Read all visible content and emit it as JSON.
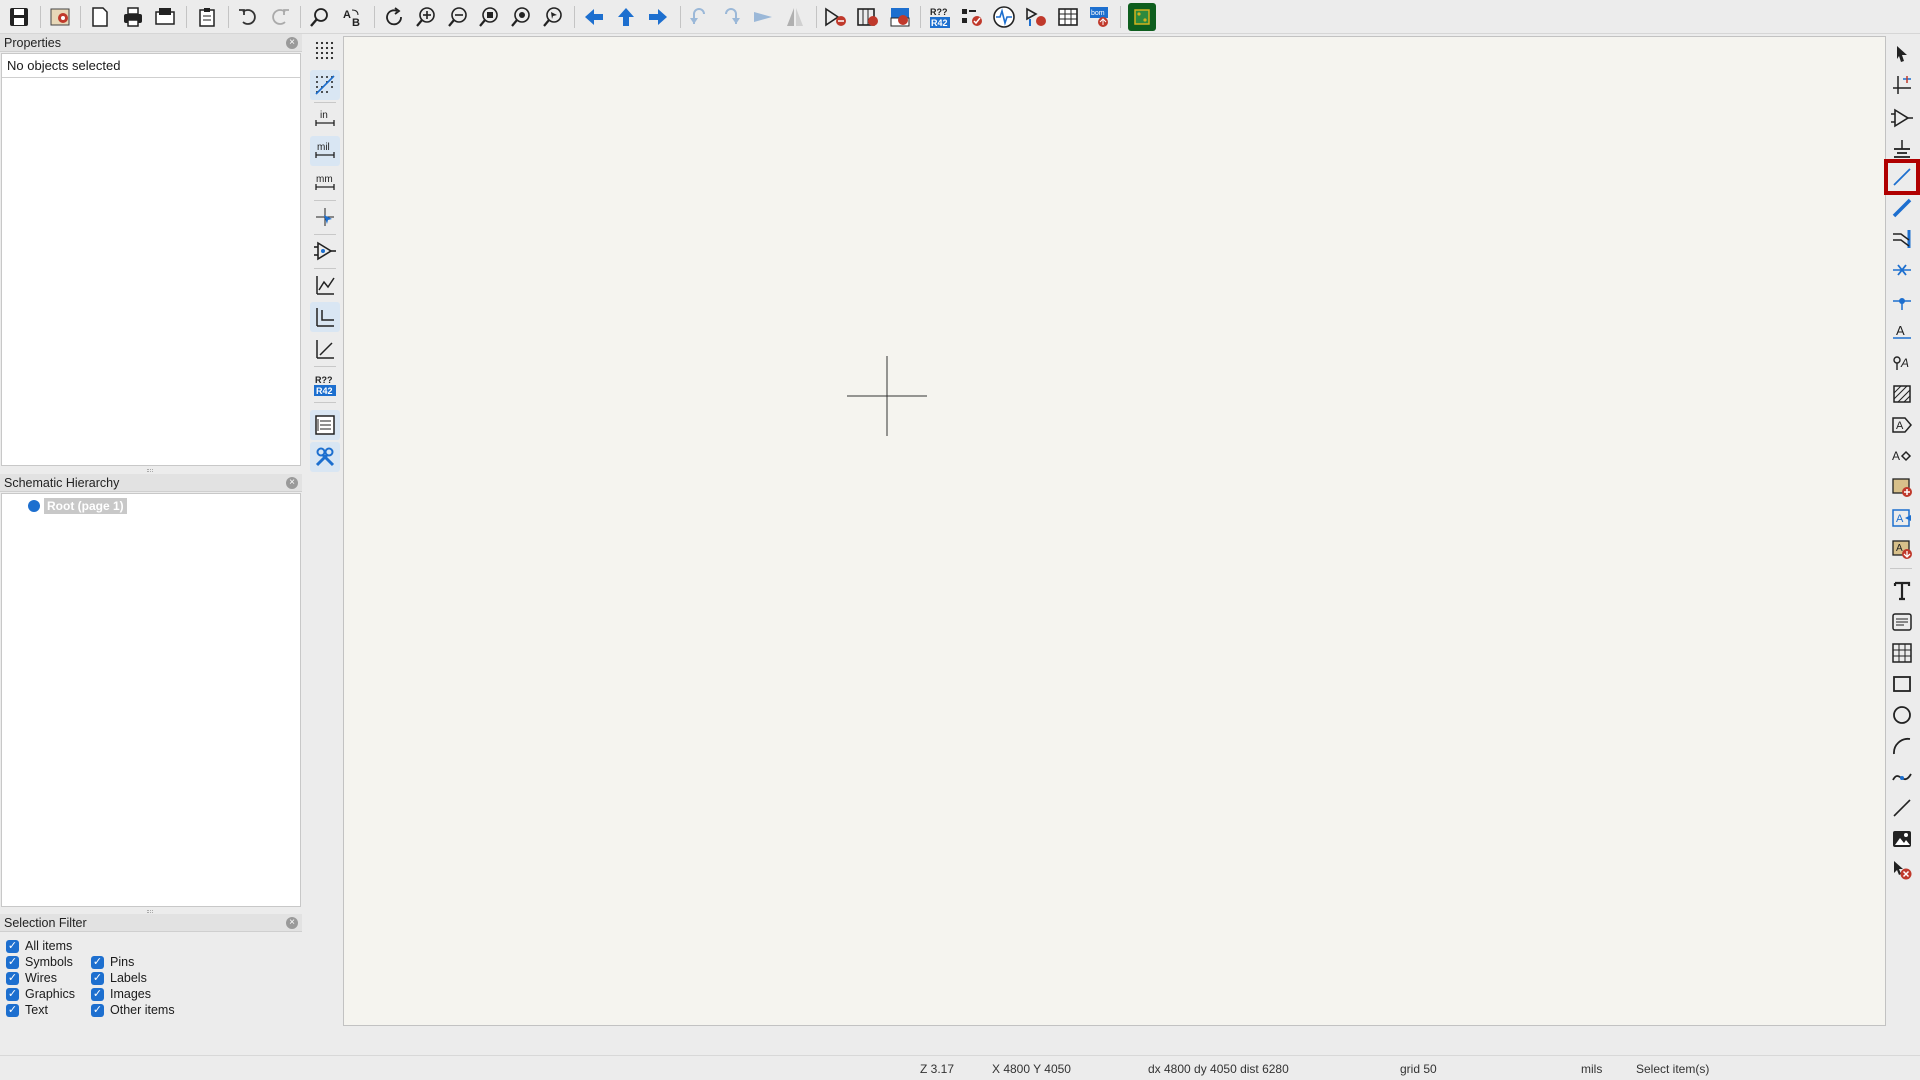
{
  "toolbar": {
    "tools": [
      "save",
      "schematic-setup",
      "page-settings",
      "print",
      "plot",
      "paste",
      "undo",
      "redo",
      "find",
      "find-replace",
      "refresh",
      "zoom-in",
      "zoom-out",
      "zoom-fit",
      "zoom-objects",
      "zoom-selection",
      "navigate-back",
      "navigate-up",
      "navigate-forward",
      "rotate-ccw",
      "rotate-cw",
      "mirror-vertical",
      "mirror-horizontal",
      "symbol-editor",
      "symbol-browser",
      "footprint-assignment",
      "annotate",
      "erc",
      "simulator",
      "bus-definitions",
      "symbol-fields-table",
      "generate-bom",
      "open-pcb"
    ]
  },
  "properties_panel": {
    "title": "Properties",
    "status": "No objects selected"
  },
  "hierarchy_panel": {
    "title": "Schematic Hierarchy",
    "root_item": "Root (page 1)"
  },
  "selection_filter": {
    "title": "Selection Filter",
    "items": [
      {
        "label": "All items",
        "checked": true
      },
      {
        "label": "Symbols",
        "checked": true
      },
      {
        "label": "Pins",
        "checked": true
      },
      {
        "label": "Wires",
        "checked": true
      },
      {
        "label": "Labels",
        "checked": true
      },
      {
        "label": "Graphics",
        "checked": true
      },
      {
        "label": "Images",
        "checked": true
      },
      {
        "label": "Text",
        "checked": true
      },
      {
        "label": "Other items",
        "checked": true
      }
    ]
  },
  "left_toolbar": {
    "unit_in": "in",
    "unit_mil": "mil",
    "unit_mm": "mm",
    "annotate_top": "R??",
    "annotate_bottom": "R42",
    "active": [
      "grid-overlay",
      "mil",
      "line-mode-90"
    ]
  },
  "right_toolbar": {
    "highlighted": "wire-tool",
    "tools": [
      "select",
      "local-ratsnest",
      "add-symbol",
      "add-power",
      "add-wire",
      "add-bus",
      "bus-entry",
      "no-connect",
      "junction",
      "net-label",
      "netclass-directive",
      "global-label",
      "hierarchical-label",
      "hierarchical-sheet",
      "import-sheet-pin",
      "sheet-pin",
      "import-graphics",
      "text",
      "textbox",
      "table",
      "rectangle",
      "circle",
      "arc",
      "bezier",
      "line",
      "image",
      "delete"
    ]
  },
  "status_bar": {
    "zoom": "Z 3.17",
    "xy": "X 4800  Y 4050",
    "delta": "dx 4800  dy 4050  dist 6280",
    "grid": "grid 50",
    "units": "mils",
    "mode": "Select item(s)"
  },
  "colors": {
    "accent_blue": "#1d6fcf",
    "highlight_red": "#b00000",
    "canvas_bg": "#f5f4ef"
  }
}
